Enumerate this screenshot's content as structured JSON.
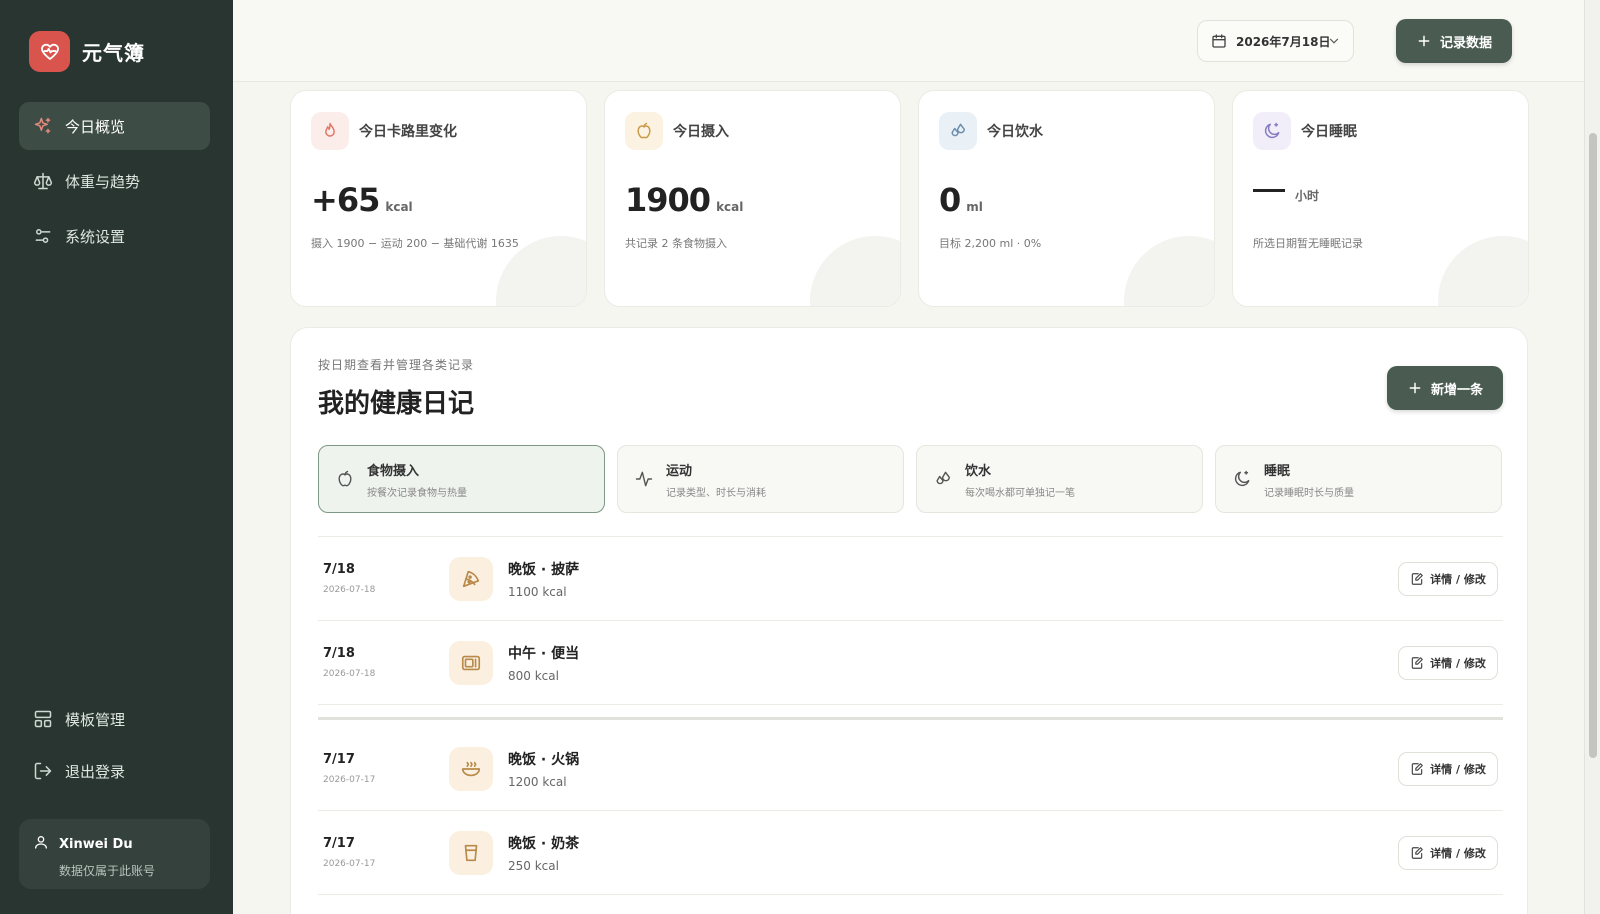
{
  "brand": {
    "name": "元气簿"
  },
  "nav": {
    "top": [
      {
        "label": "今日概览",
        "icon": "sparkles-icon",
        "active": true
      },
      {
        "label": "体重与趋势",
        "icon": "scale-icon",
        "active": false
      },
      {
        "label": "系统设置",
        "icon": "sliders-icon",
        "active": false
      }
    ],
    "bottom": [
      {
        "label": "模板管理",
        "icon": "layout-icon"
      },
      {
        "label": "退出登录",
        "icon": "logout-icon"
      }
    ]
  },
  "user": {
    "name": "Xinwei Du",
    "note": "数据仅属于此账号"
  },
  "header": {
    "date": "2026年7月18日",
    "record_label": "记录数据"
  },
  "stats": [
    {
      "title": "今日卡路里变化",
      "value": "+65",
      "unit": "kcal",
      "sub": "摄入 1900 − 运动 200 − 基础代谢 1635",
      "icon": "flame-icon",
      "color": "#fbeeea"
    },
    {
      "title": "今日摄入",
      "value": "1900",
      "unit": "kcal",
      "sub": "共记录 2 条食物摄入",
      "icon": "apple-icon",
      "color": "#fcf2e2"
    },
    {
      "title": "今日饮水",
      "value": "0",
      "unit": "ml",
      "sub": "目标 2,200 ml · 0%",
      "icon": "droplets-icon",
      "color": "#e9f1f7"
    },
    {
      "title": "今日睡眠",
      "value": "",
      "unit": "小时",
      "sub": "所选日期暂无睡眠记录",
      "icon": "moon-icon",
      "color": "#f1eefa"
    }
  ],
  "diary": {
    "subtitle": "按日期查看并管理各类记录",
    "title": "我的健康日记",
    "add_label": "新增一条",
    "tabs": [
      {
        "name": "食物摄入",
        "desc": "按餐次记录食物与热量",
        "active": true
      },
      {
        "name": "运动",
        "desc": "记录类型、时长与消耗",
        "active": false
      },
      {
        "name": "饮水",
        "desc": "每次喝水都可单独记一笔",
        "active": false
      },
      {
        "name": "睡眠",
        "desc": "记录睡眠时长与质量",
        "active": false
      }
    ],
    "edit_label": "详情 / 修改",
    "entries": [
      {
        "date": "7/18",
        "full_date": "2026-07-18",
        "title": "晚饭 · 披萨",
        "kcal": "1100 kcal",
        "icon": "pizza-icon"
      },
      {
        "date": "7/18",
        "full_date": "2026-07-18",
        "title": "中午 · 便当",
        "kcal": "800 kcal",
        "icon": "bento-icon"
      },
      {
        "date": "7/17",
        "full_date": "2026-07-17",
        "title": "晚饭 · 火锅",
        "kcal": "1200 kcal",
        "icon": "hotpot-icon"
      },
      {
        "date": "7/17",
        "full_date": "2026-07-17",
        "title": "晚饭 · 奶茶",
        "kcal": "250 kcal",
        "icon": "cup-icon"
      }
    ]
  }
}
